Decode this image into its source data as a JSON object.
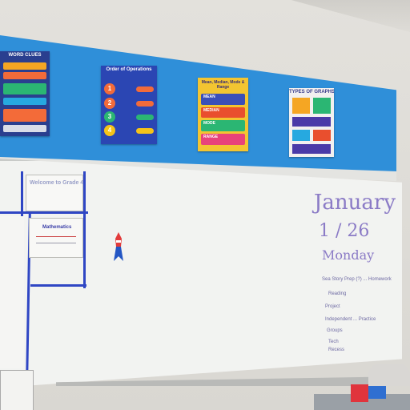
{
  "posters": {
    "word_clues": "WORD CLUES",
    "order_ops": "Order of Operations",
    "ops_numbers": [
      "1",
      "2",
      "3",
      "4"
    ],
    "mmmr_title": "Mean, Median, Mode & Range",
    "mean": "MEAN",
    "median": "MEDIAN",
    "mode": "MODE",
    "range": "RANGE",
    "graphs": "TYPES OF GRAPHS"
  },
  "board": {
    "paper_top": "Welcome to Grade 4",
    "paper_subject": "Mathematics",
    "month": "January",
    "date": "1 / 26",
    "day": "Monday",
    "notes": [
      "Sea Story Prep (?) ... Homework",
      "Reading",
      "Project",
      "Independent ... Practice",
      "Groups",
      "Tech",
      "Recess"
    ]
  },
  "colors": {
    "banner": "#2f8fd9",
    "tape": "#2f46c4",
    "marker": "#8b7bc6"
  }
}
